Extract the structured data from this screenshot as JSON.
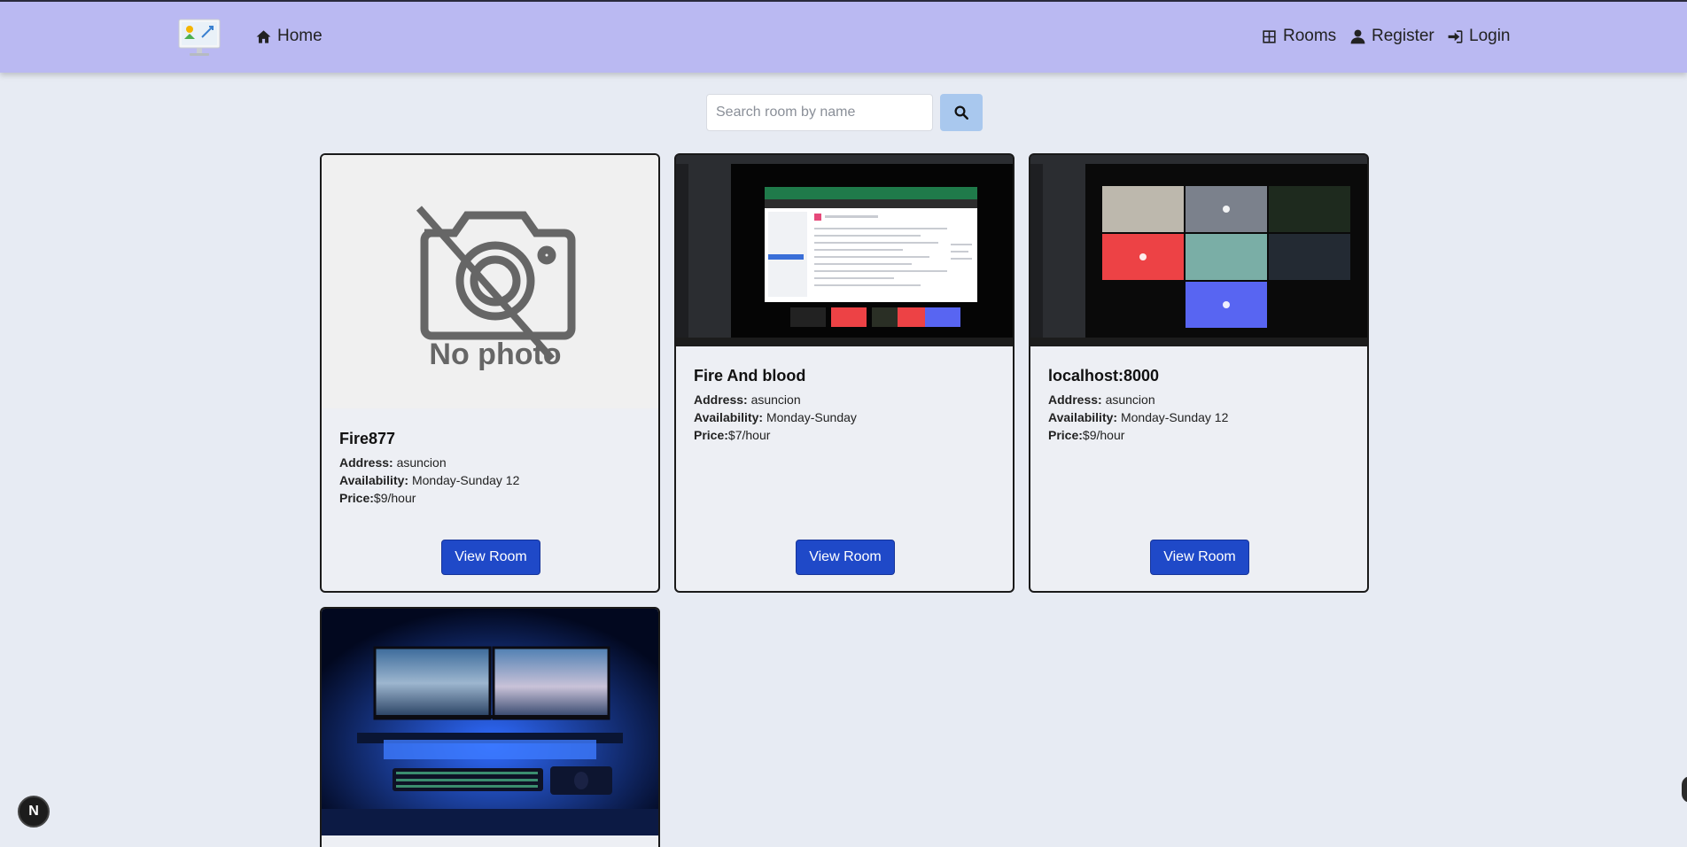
{
  "nav": {
    "home": "Home",
    "rooms": "Rooms",
    "register": "Register",
    "login": "Login"
  },
  "search": {
    "placeholder": "Search room by name"
  },
  "labels": {
    "address": "Address:",
    "availability": "Availability:",
    "price": "Price:",
    "view_room": "View Room",
    "no_photo": "No photo"
  },
  "rooms": [
    {
      "name": "Fire877",
      "address": "asuncion",
      "availability": "Monday-Sunday 12",
      "price": "$9/hour",
      "image": "no-photo"
    },
    {
      "name": "Fire And blood",
      "address": "asuncion",
      "availability": "Monday-Sunday",
      "price": "$7/hour",
      "image": "screenshot-video-call"
    },
    {
      "name": "localhost:8000",
      "address": "asuncion",
      "availability": "Monday-Sunday 12",
      "price": "$9/hour",
      "image": "screenshot-video-grid"
    },
    {
      "image": "desk-setup-photo"
    }
  ],
  "badge": {
    "letter": "N"
  },
  "colors": {
    "topbar": "#bab9f2",
    "background": "#e7ebf3",
    "button": "#1f49c8",
    "search_button": "#a9c8ee"
  }
}
